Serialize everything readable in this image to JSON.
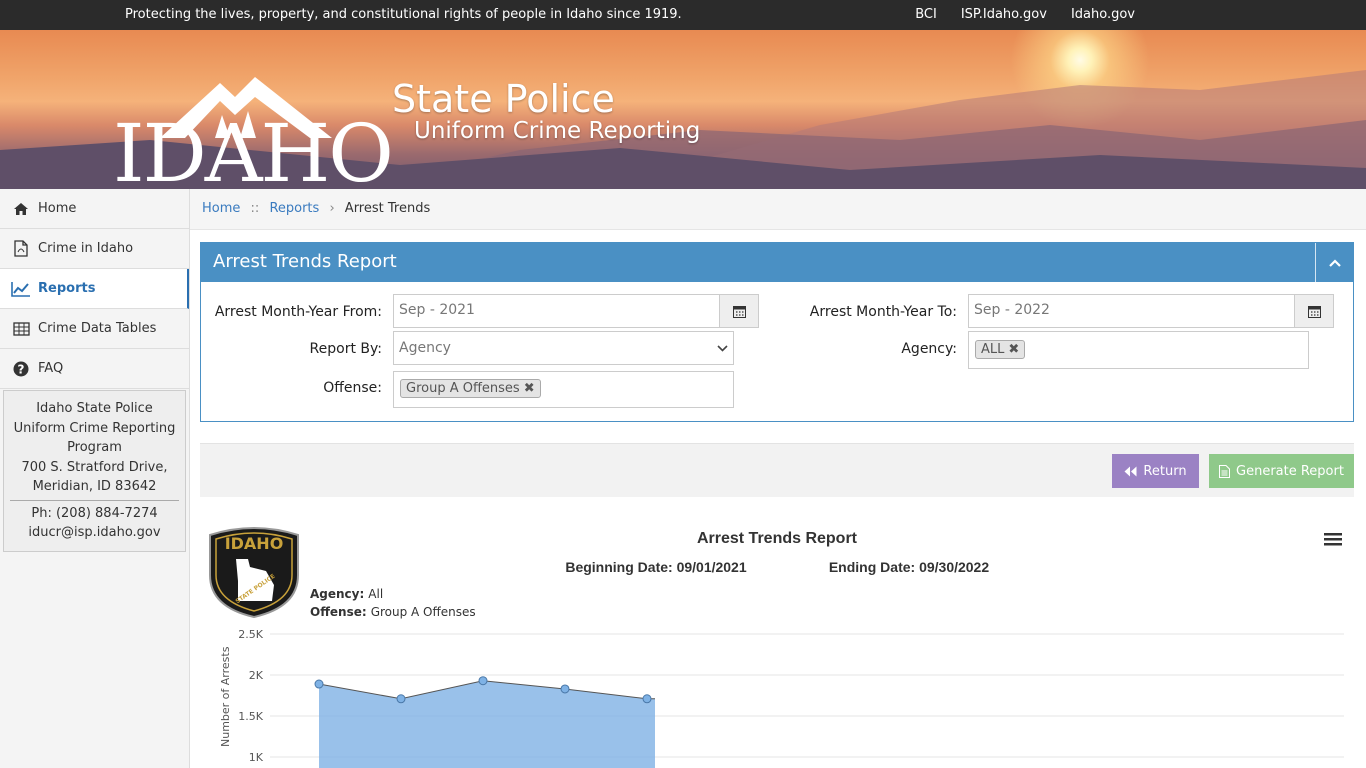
{
  "topbar": {
    "motto": "Protecting the lives, property, and constitutional rights of people in Idaho since 1919.",
    "links": [
      "BCI",
      "ISP.Idaho.gov",
      "Idaho.gov"
    ]
  },
  "banner": {
    "logo_text": "IDAHO",
    "title": "State Police",
    "subtitle": "Uniform Crime Reporting"
  },
  "sidebar": {
    "items": [
      {
        "label": "Home",
        "icon": "home-icon"
      },
      {
        "label": "Crime in Idaho",
        "icon": "pdf-file-icon"
      },
      {
        "label": "Reports",
        "icon": "line-chart-icon",
        "active": true
      },
      {
        "label": "Crime Data Tables",
        "icon": "table-icon"
      },
      {
        "label": "FAQ",
        "icon": "question-circle-icon"
      }
    ],
    "info": {
      "org": "Idaho State Police Uniform Crime Reporting Program",
      "address1": "700 S. Stratford Drive,",
      "address2": "Meridian, ID 83642",
      "phone": "Ph: (208) 884-7274",
      "email": "iducr@isp.idaho.gov"
    }
  },
  "breadcrumb": {
    "home": "Home",
    "sep1": "::",
    "reports": "Reports",
    "sep2": "›",
    "current": "Arrest Trends"
  },
  "panel": {
    "title": "Arrest Trends Report",
    "from_label": "Arrest Month-Year From:",
    "from_value": "Sep - 2021",
    "to_label": "Arrest Month-Year To:",
    "to_value": "Sep - 2022",
    "report_by_label": "Report By:",
    "report_by_value": "Agency",
    "agency_label": "Agency:",
    "agency_tag": "ALL",
    "offense_label": "Offense:",
    "offense_tag": "Group A Offenses"
  },
  "actions": {
    "return_label": "Return",
    "generate_label": "Generate Report",
    "return_color": "#9b82c4",
    "generate_color": "#8fc98a"
  },
  "chart_data": {
    "type": "area",
    "title": "Arrest Trends Report",
    "beginning": "Beginning Date: 09/01/2021",
    "ending": "Ending Date: 09/30/2022",
    "agency_label": "Agency:",
    "agency_value": "All",
    "offense_label": "Offense:",
    "offense_value": "Group A Offenses",
    "badge_text": "IDAHO",
    "badge_sub": "STATE POLICE",
    "ylabel": "Number of Arrests",
    "ytick_labels": [
      "2.5K",
      "2K",
      "1.5K",
      "1K"
    ],
    "yticks": [
      2500,
      2000,
      1500,
      1000
    ],
    "ylim": [
      1000,
      2500
    ],
    "values": [
      1890,
      1710,
      1930,
      1830,
      1710
    ],
    "color": "#7fb2e5",
    "grid": true
  }
}
